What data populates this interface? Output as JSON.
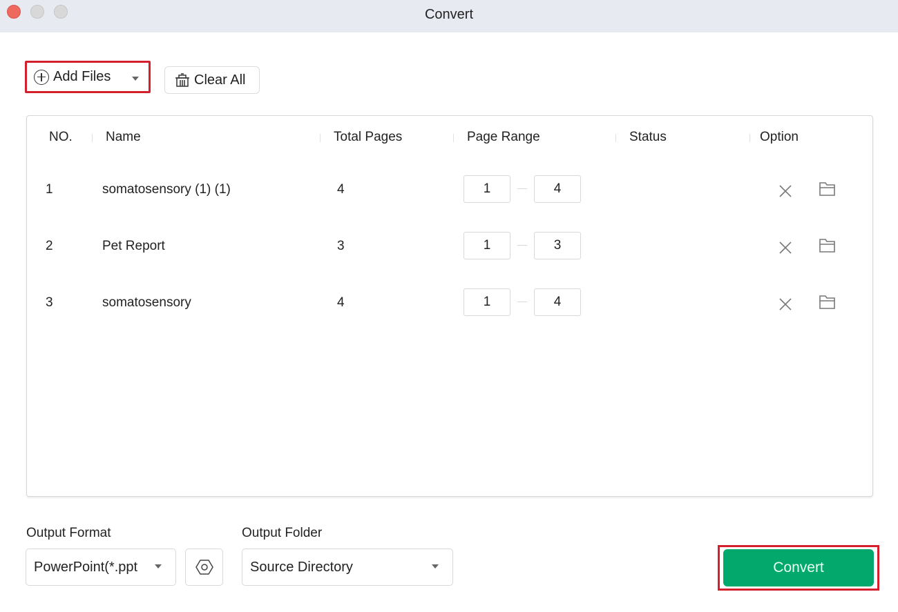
{
  "window": {
    "title": "Convert"
  },
  "toolbar": {
    "add_files_label": "Add Files",
    "clear_all_label": "Clear All"
  },
  "table": {
    "columns": [
      "NO.",
      "Name",
      "Total Pages",
      "Page Range",
      "Status",
      "Option"
    ],
    "rows": [
      {
        "no": "1",
        "name": "somatosensory (1) (1)",
        "total_pages": "4",
        "range_from": "1",
        "range_to": "4",
        "status": ""
      },
      {
        "no": "2",
        "name": "Pet Report",
        "total_pages": "3",
        "range_from": "1",
        "range_to": "3",
        "status": ""
      },
      {
        "no": "3",
        "name": "somatosensory",
        "total_pages": "4",
        "range_from": "1",
        "range_to": "4",
        "status": ""
      }
    ],
    "option_icons": [
      "close-icon",
      "folder-icon"
    ]
  },
  "output": {
    "format_label": "Output Format",
    "format_value": "PowerPoint(*.pptx)",
    "folder_label": "Output Folder",
    "folder_value": "Source Directory"
  },
  "actions": {
    "convert_label": "Convert"
  },
  "colors": {
    "accent_green": "#03a96c",
    "highlight_red": "#d4202c",
    "titlebar_bg": "#e8eaf1"
  }
}
